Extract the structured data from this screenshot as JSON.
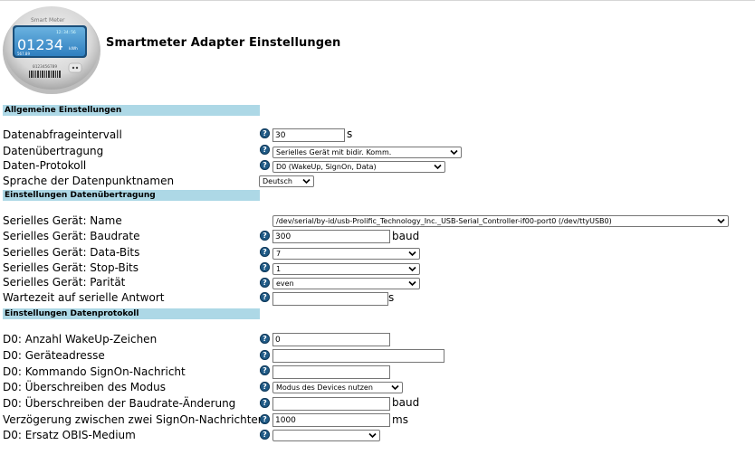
{
  "title": "Smartmeter Adapter Einstellungen",
  "logo": {
    "brand": "Smart Meter",
    "time": "12:34:56",
    "reading": "01234",
    "unit": "kWh",
    "sub": "567.89",
    "serial": "0123456789"
  },
  "sections": {
    "general": "Allgemeine Einstellungen",
    "transfer": "Einstellungen Datenübertragung",
    "protocol": "Einstellungen Datenprotokoll"
  },
  "general": {
    "interval_label": "Datenabfrageintervall",
    "interval_value": "30",
    "interval_unit": "s",
    "transfer_label": "Datenübertragung",
    "transfer_value": "Serielles Gerät mit bidir. Komm.",
    "protocol_label": "Daten-Protokoll",
    "protocol_value": "D0 (WakeUp, SignOn, Data)",
    "language_label": "Sprache der Datenpunktnamen",
    "language_value": "Deutsch"
  },
  "transfer": {
    "name_label": "Serielles Gerät: Name",
    "name_value": "/dev/serial/by-id/usb-Prolific_Technology_Inc._USB-Serial_Controller-if00-port0 (/dev/ttyUSB0)",
    "baud_label": "Serielles Gerät: Baudrate",
    "baud_value": "300",
    "baud_unit": "baud",
    "databits_label": "Serielles Gerät: Data-Bits",
    "databits_value": "7",
    "stopbits_label": "Serielles Gerät: Stop-Bits",
    "stopbits_value": "1",
    "parity_label": "Serielles Gerät: Parität",
    "parity_value": "even",
    "wait_label": "Wartezeit auf serielle Antwort",
    "wait_value": "",
    "wait_unit": "s"
  },
  "protocol": {
    "wakeup_label": "D0: Anzahl WakeUp-Zeichen",
    "wakeup_value": "0",
    "address_label": "D0: Geräteadresse",
    "address_value": "",
    "signon_label": "D0: Kommando SignOn-Nachricht",
    "signon_value": "",
    "mode_label": "D0: Überschreiben des Modus",
    "mode_value": "Modus des Devices nutzen",
    "baudchange_label": "D0: Überschreiben der Baudrate-Änderung",
    "baudchange_value": "",
    "baudchange_unit": "baud",
    "delay_label": "Verzögerung zwischen zwei SignOn-Nachrichten",
    "delay_value": "1000",
    "delay_unit": "ms",
    "obis_label": "D0: Ersatz OBIS-Medium",
    "obis_value": ""
  },
  "help_glyph": "?"
}
